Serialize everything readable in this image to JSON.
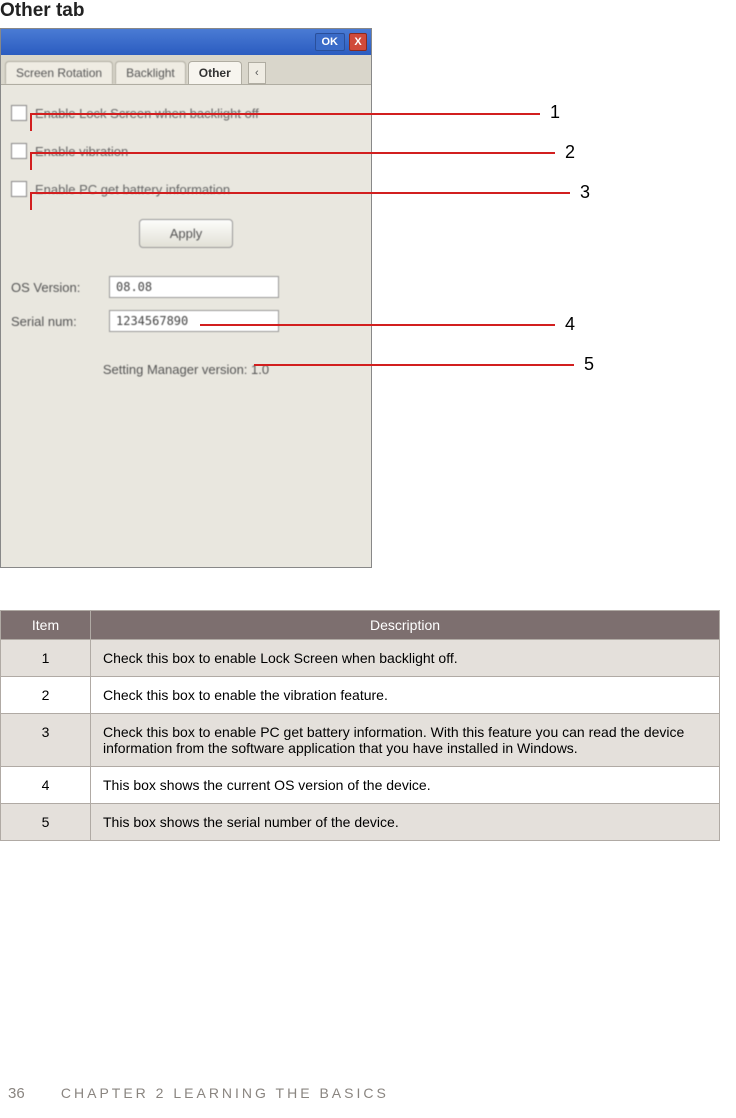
{
  "page": {
    "title": "Other tab"
  },
  "window": {
    "ok": "OK",
    "close": "X",
    "tabs": {
      "screenRotation": "Screen Rotation",
      "backlight": "Backlight",
      "other": "Other"
    },
    "scrollLeft": "‹"
  },
  "panel": {
    "check1": "Enable Lock Screen when backlight off",
    "check2": "Enable vibration",
    "check3": "Enable PC get battery information",
    "apply": "Apply",
    "osLabel": "OS Version:",
    "osValue": "08.08",
    "serialLabel": "Serial num:",
    "serialValue": "1234567890",
    "versionText": "Setting Manager version: 1.0"
  },
  "callouts": {
    "n1": "1",
    "n2": "2",
    "n3": "3",
    "n4": "4",
    "n5": "5"
  },
  "table": {
    "headItem": "Item",
    "headDesc": "Description",
    "rows": [
      {
        "item": "1",
        "desc": "Check this box to enable Lock Screen when backlight off."
      },
      {
        "item": "2",
        "desc": "Check this box to enable the vibration feature."
      },
      {
        "item": "3",
        "desc": "Check this box to enable PC get battery information. With this feature you can read the device information from the software application that you have installed in Windows."
      },
      {
        "item": "4",
        "desc": "This box shows the current OS version of the device."
      },
      {
        "item": "5",
        "desc": "This box shows the serial number of the device."
      }
    ]
  },
  "footer": {
    "pageNum": "36",
    "chapter": "CHAPTER 2 LEARNING THE BASICS"
  }
}
